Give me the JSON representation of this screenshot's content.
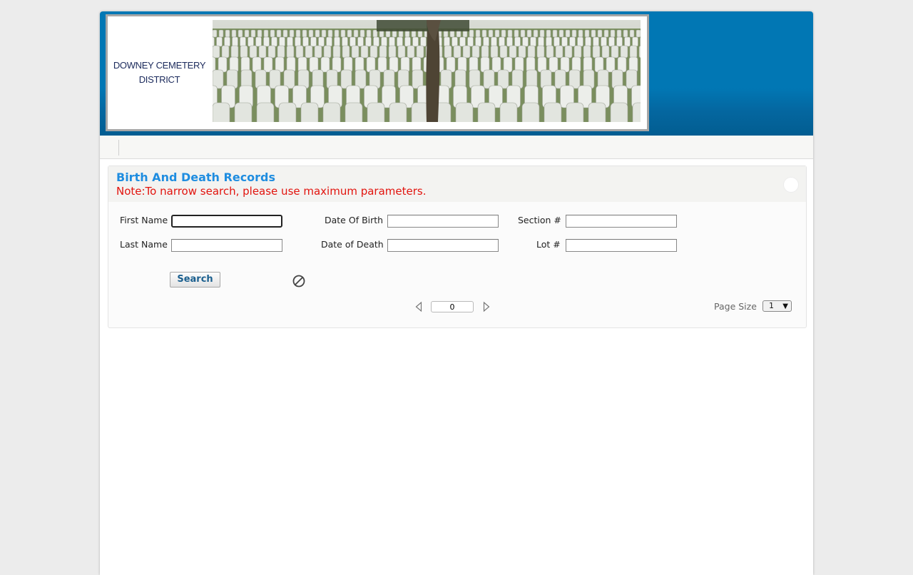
{
  "header": {
    "logo_line1": "DOWNEY CEMETERY",
    "logo_line2": "DISTRICT",
    "brand_color": "#0177b4"
  },
  "panel": {
    "title": "Birth And Death Records",
    "note": "Note:To narrow search, please use maximum parameters.",
    "title_color": "#1f8de0",
    "note_color": "#e2140e"
  },
  "form": {
    "first_name_label": "First Name",
    "first_name_value": "",
    "last_name_label": "Last Name",
    "last_name_value": "",
    "dob_label": "Date Of Birth",
    "dob_value": "",
    "dod_label": "Date of Death",
    "dod_value": "",
    "section_label": "Section #",
    "section_value": "",
    "lot_label": "Lot #",
    "lot_value": "",
    "search_label": "Search",
    "cancel_icon": "cancel-icon"
  },
  "pager": {
    "page_value": "0",
    "page_size_label": "Page Size",
    "page_size_value": "1",
    "prev_icon": "triangle-left-icon",
    "next_icon": "triangle-right-icon"
  }
}
